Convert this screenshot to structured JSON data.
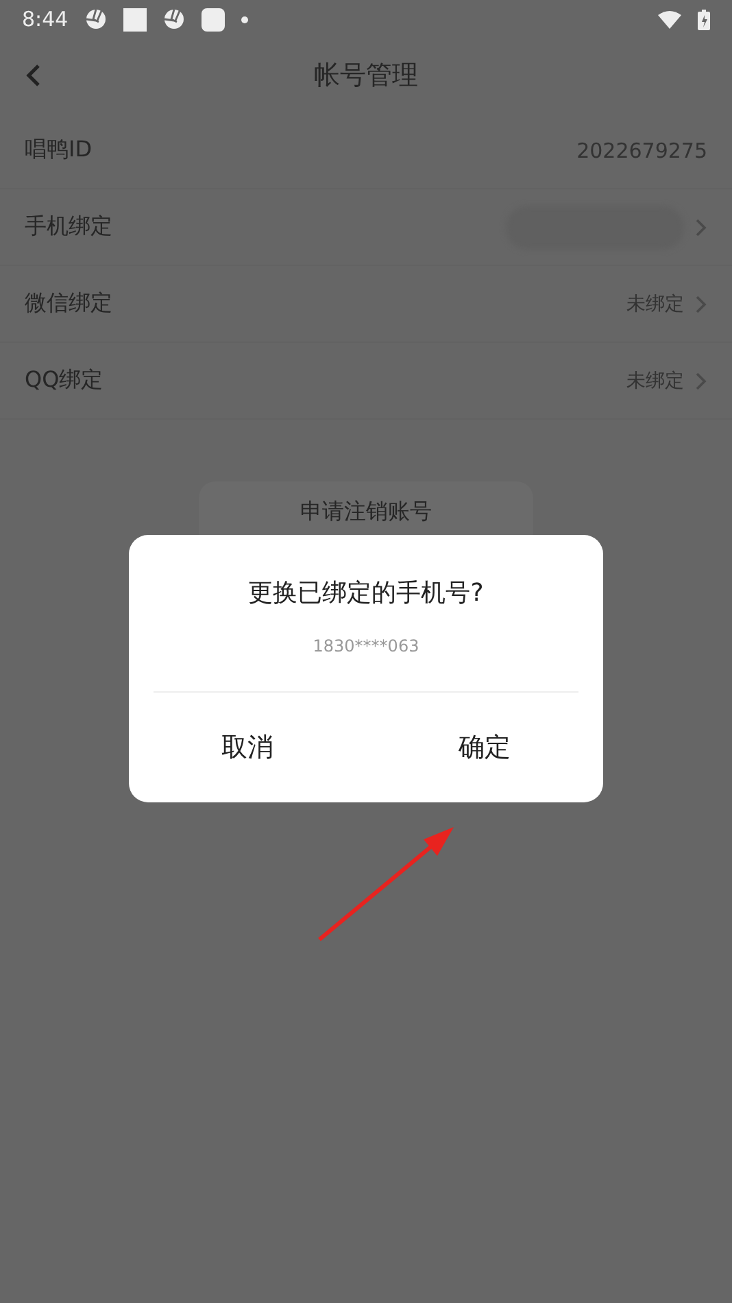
{
  "status_bar": {
    "time": "8:44"
  },
  "header": {
    "title": "帐号管理"
  },
  "rows": [
    {
      "kind": "value",
      "label": "唱鸭ID",
      "value": "2022679275"
    },
    {
      "kind": "hidden",
      "label": "手机绑定"
    },
    {
      "kind": "link",
      "label": "微信绑定",
      "value": "未绑定"
    },
    {
      "kind": "link",
      "label": "QQ绑定",
      "value": "未绑定"
    }
  ],
  "cancel_account_button": "申请注销账号",
  "dialog": {
    "title": "更换已绑定的手机号?",
    "subtitle": "1830****063",
    "buttons": [
      "取消",
      "确定"
    ]
  }
}
